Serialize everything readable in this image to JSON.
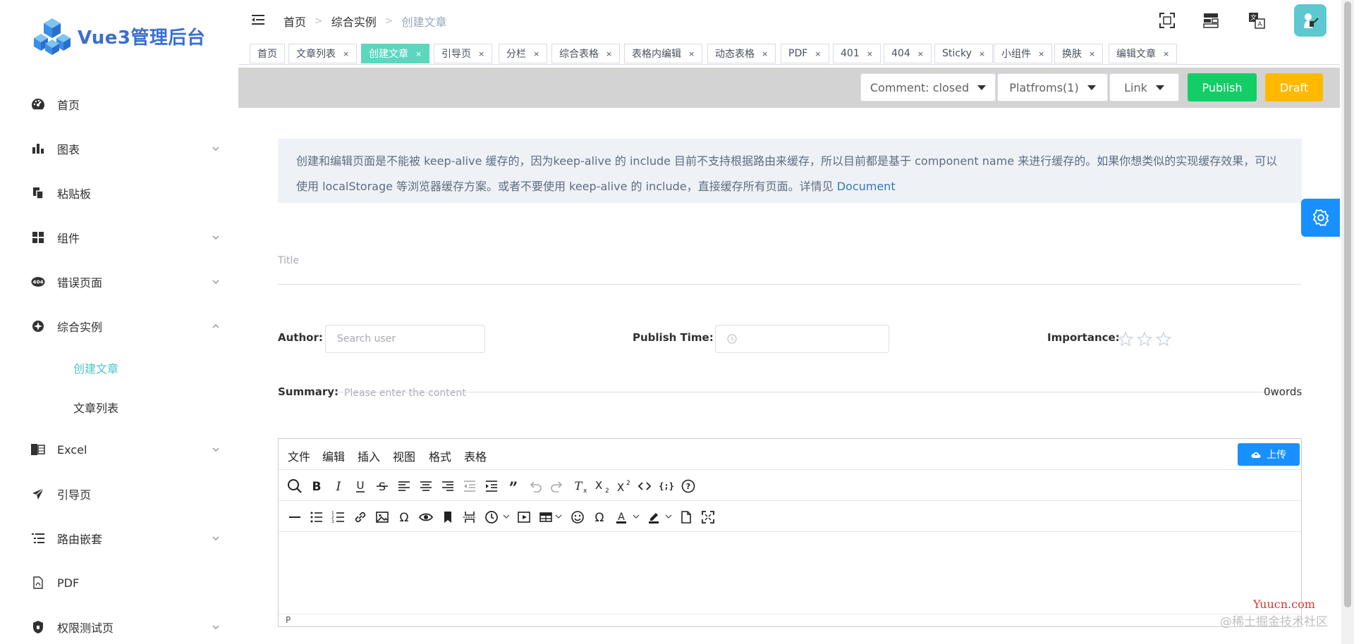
{
  "app": {
    "title": "Vue3管理后台",
    "logo": "vue3-cube-logo"
  },
  "sidebar": {
    "items": [
      {
        "label": "首页",
        "icon": "dashboard-icon",
        "expandable": false
      },
      {
        "label": "图表",
        "icon": "chart-icon",
        "expandable": true
      },
      {
        "label": "粘贴板",
        "icon": "clipboard-icon",
        "expandable": false
      },
      {
        "label": "组件",
        "icon": "component-icon",
        "expandable": true
      },
      {
        "label": "错误页面",
        "icon": "404-icon",
        "expandable": true
      },
      {
        "label": "综合实例",
        "icon": "example-icon",
        "expandable": true,
        "expanded": true
      },
      {
        "label": "Excel",
        "icon": "excel-icon",
        "expandable": true
      },
      {
        "label": "引导页",
        "icon": "guide-icon",
        "expandable": false
      },
      {
        "label": "路由嵌套",
        "icon": "nested-icon",
        "expandable": true
      },
      {
        "label": "PDF",
        "icon": "pdf-icon",
        "expandable": false
      },
      {
        "label": "权限测试页",
        "icon": "lock-icon",
        "expandable": true
      }
    ],
    "subitems": [
      {
        "label": "创建文章",
        "active": true
      },
      {
        "label": "文章列表",
        "active": false
      }
    ]
  },
  "navbar": {
    "breadcrumb": [
      "首页",
      "综合实例",
      "创建文章"
    ]
  },
  "tags": [
    {
      "label": "首页",
      "closable": false
    },
    {
      "label": "文章列表",
      "closable": true
    },
    {
      "label": "创建文章",
      "closable": true,
      "active": true
    },
    {
      "label": "引导页",
      "closable": true
    },
    {
      "label": "分栏",
      "closable": true
    },
    {
      "label": "综合表格",
      "closable": true
    },
    {
      "label": "表格内编辑",
      "closable": true
    },
    {
      "label": "动态表格",
      "closable": true
    },
    {
      "label": "PDF",
      "closable": true
    },
    {
      "label": "401",
      "closable": true
    },
    {
      "label": "404",
      "closable": true
    },
    {
      "label": "Sticky",
      "closable": true
    },
    {
      "label": "小组件",
      "closable": true
    },
    {
      "label": "换肤",
      "closable": true
    },
    {
      "label": "编辑文章",
      "closable": true
    }
  ],
  "subnav": {
    "comment": "Comment: closed",
    "platforms": "Platfroms(1)",
    "link": "Link",
    "publish": "Publish",
    "draft": "Draft"
  },
  "tip": {
    "text": "创建和编辑页面是不能被 keep-alive 缓存的，因为keep-alive 的 include 目前不支持根据路由来缓存，所以目前都是基于 component name 来进行缓存的。如果你想类似的实现缓存效果，可以使用 localStorage 等浏览器缓存方案。或者不要使用 keep-alive 的 include，直接缓存所有页面。详情见 ",
    "link": "Document"
  },
  "form": {
    "title_placeholder": "Title",
    "author_label": "Author:",
    "author_placeholder": "Search user",
    "publish_time_label": "Publish Time:",
    "importance_label": "Importance:",
    "importance_value": 0,
    "importance_max": 3,
    "summary_label": "Summary:",
    "summary_placeholder": "Please enter the content",
    "word_count": "0words"
  },
  "editor": {
    "menus": [
      "文件",
      "编辑",
      "插入",
      "视图",
      "格式",
      "表格"
    ],
    "upload": "上传",
    "status_path": "P"
  },
  "watermark": {
    "text": "@稀土掘金技术社区",
    "site": "Yuucn.com"
  },
  "colors": {
    "accent": "#5dd6c0",
    "primary": "#1890ff",
    "publish": "#13ce66",
    "draft": "#ffba00"
  }
}
